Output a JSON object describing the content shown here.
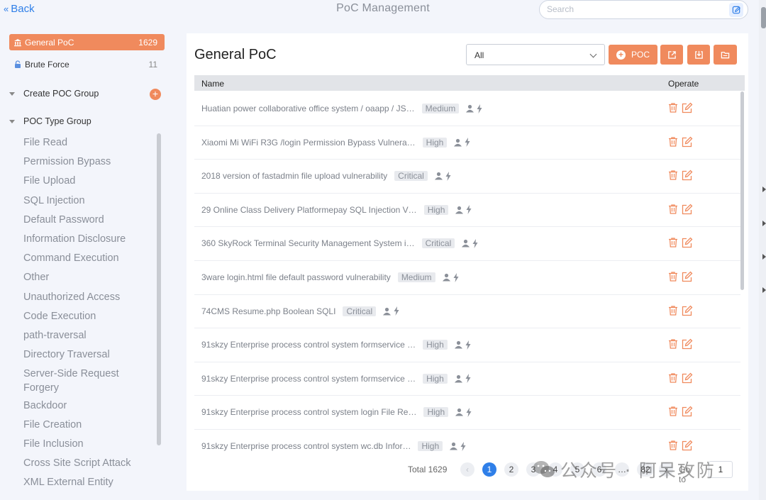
{
  "topbar": {
    "back_label": "Back",
    "title": "PoC Management",
    "search_placeholder": "Search"
  },
  "sidebar": {
    "items": [
      {
        "label": "General PoC",
        "count": "1629",
        "active": true,
        "icon": "bank-icon"
      },
      {
        "label": "Brute Force",
        "count": "11",
        "active": false,
        "icon": "lock-icon"
      }
    ],
    "create_group_label": "Create POC Group",
    "type_group_label": "POC Type Group",
    "types": [
      "File Read",
      "Permission Bypass",
      "File Upload",
      "SQL Injection",
      "Default Password",
      "Information Disclosure",
      "Command Execution",
      "Other",
      "Unauthorized Access",
      "Code Execution",
      "path-traversal",
      "Directory Traversal",
      "Server-Side Request Forgery",
      "Backdoor",
      "File Creation",
      "File Inclusion",
      "Cross Site Script Attack",
      "XML External Entity"
    ]
  },
  "main": {
    "title": "General PoC",
    "filter_value": "All",
    "add_poc_label": "POC",
    "columns": {
      "name": "Name",
      "operate": "Operate"
    },
    "rows": [
      {
        "name": "Huatian power collaborative office system / oaapp / JS…",
        "severity": "Medium"
      },
      {
        "name": "Xiaomi Mi WiFi R3G /login Permission Bypass Vulnera…",
        "severity": "High"
      },
      {
        "name": "2018 version of fastadmin file upload vulnerability",
        "severity": "Critical"
      },
      {
        "name": "29 Online Class Delivery Platformepay SQL Injection V…",
        "severity": "High"
      },
      {
        "name": "360 SkyRock Terminal Security Management System i…",
        "severity": "Critical"
      },
      {
        "name": "3ware login.html file default password vulnerability",
        "severity": "Medium"
      },
      {
        "name": "74CMS Resume.php Boolean SQLI",
        "severity": "Critical"
      },
      {
        "name": "91skzy Enterprise process control system formservice …",
        "severity": "High"
      },
      {
        "name": "91skzy Enterprise process control system formservice …",
        "severity": "High"
      },
      {
        "name": "91skzy Enterprise process control system login File Re…",
        "severity": "High"
      },
      {
        "name": "91skzy Enterprise process control system wc.db Infor…",
        "severity": "High"
      }
    ]
  },
  "pagination": {
    "total_label": "Total 1629",
    "pages": [
      "1",
      "2",
      "3",
      "4",
      "5",
      "6",
      "…",
      "82"
    ],
    "current": "1",
    "goto_label": "Go to",
    "goto_value": "1"
  },
  "watermark": {
    "text": "公众号 · 阿呆攻防"
  },
  "colors": {
    "accent": "#f08a5d",
    "link": "#2f7fe8",
    "page_current": "#2f7fe8"
  }
}
